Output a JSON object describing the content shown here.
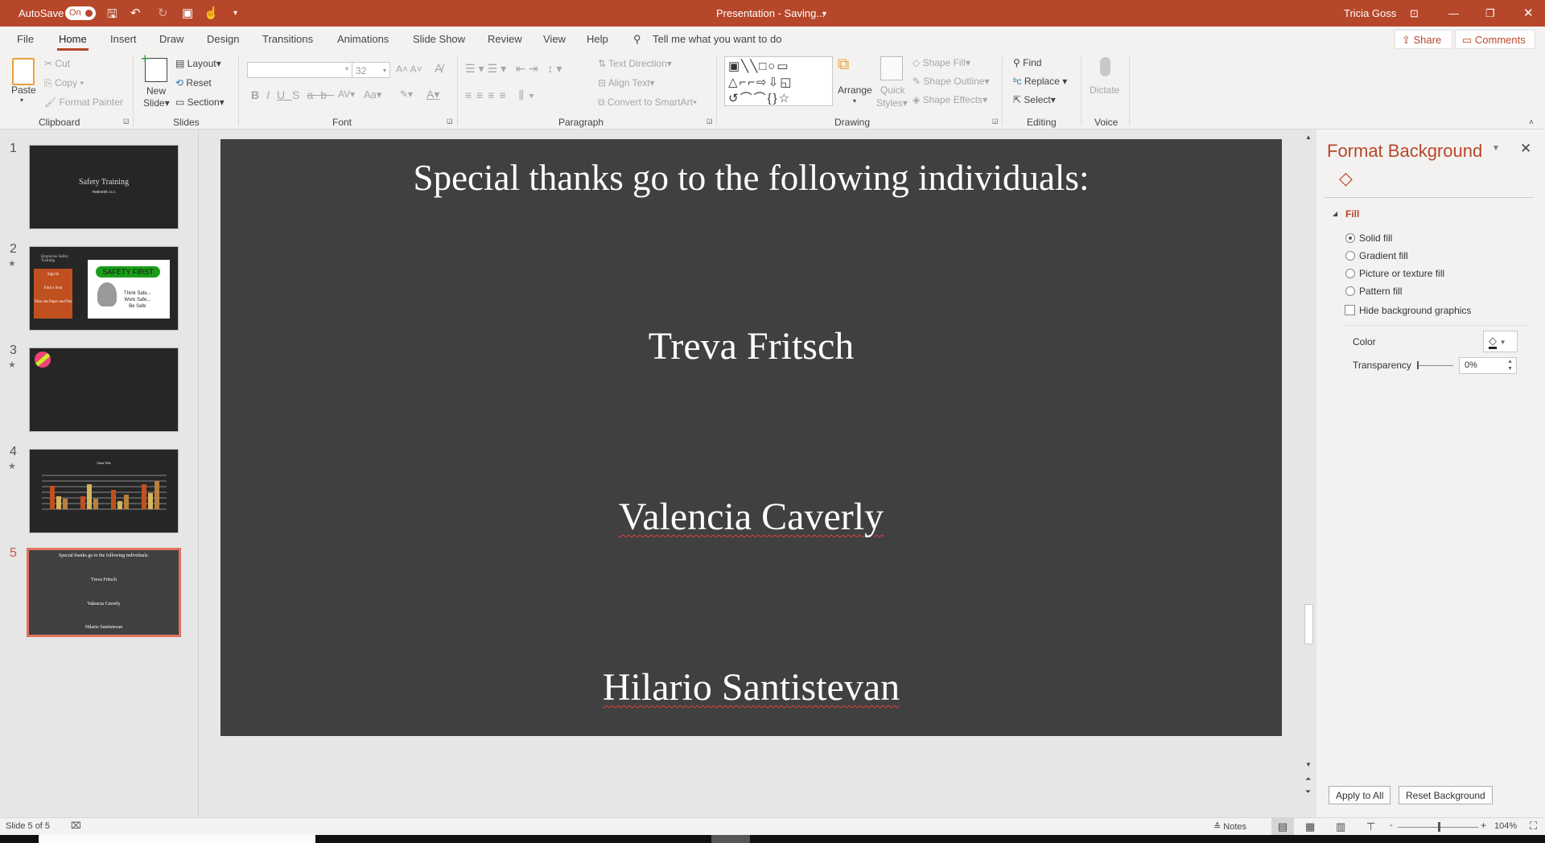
{
  "titlebar": {
    "autosave_label": "AutoSave",
    "autosave_state": "On",
    "title": "Presentation - Saving...",
    "user": "Tricia Goss",
    "accent": "#b7472a"
  },
  "tabs": [
    "File",
    "Home",
    "Insert",
    "Draw",
    "Design",
    "Transitions",
    "Animations",
    "Slide Show",
    "Review",
    "View",
    "Help"
  ],
  "active_tab": "Home",
  "search": {
    "placeholder": "Tell me what you want to do"
  },
  "share_label": "Share",
  "comments_label": "Comments",
  "ribbon": {
    "clipboard": {
      "paste": "Paste",
      "cut": "Cut",
      "copy": "Copy",
      "format_painter": "Format Painter",
      "label": "Clipboard"
    },
    "slides": {
      "new": "New",
      "slide": "Slide",
      "layout": "Layout",
      "reset": "Reset",
      "section": "Section",
      "label": "Slides"
    },
    "font": {
      "font_name": "",
      "font_size": "32",
      "label": "Font"
    },
    "paragraph": {
      "text_direction": "Text Direction",
      "align_text": "Align Text",
      "smartart": "Convert to SmartArt",
      "label": "Paragraph"
    },
    "drawing": {
      "arrange": "Arrange",
      "quick": "Quick",
      "styles": "Styles",
      "shape_fill": "Shape Fill",
      "shape_outline": "Shape Outline",
      "shape_effects": "Shape Effects",
      "label": "Drawing"
    },
    "editing": {
      "find": "Find",
      "replace": "Replace",
      "select": "Select",
      "label": "Editing"
    },
    "voice": {
      "dictate": "Dictate",
      "label": "Voice"
    }
  },
  "thumbnails": [
    {
      "num": "1",
      "title": "Safety Training",
      "subtitle": "PARKSIDE, LLC"
    },
    {
      "num": "2",
      "title": "Employee Safety Training",
      "items": [
        "Sign In",
        "Find a Seat",
        "Take out Paper and Pen"
      ],
      "banner": "SAFETY FIRST",
      "lines": [
        "Think Safe...",
        "Work Safe...",
        "Be Safe"
      ]
    },
    {
      "num": "3"
    },
    {
      "num": "4",
      "title": "Chart Title"
    },
    {
      "num": "5",
      "title": "Special thanks go to the following individuals:",
      "names": [
        "Treva Fritsch",
        "Valencia Caverly",
        "Hilario Santistevan"
      ]
    }
  ],
  "slide": {
    "title": "Special thanks go to the following individuals:",
    "names": [
      "Treva Fritsch",
      "Valencia Caverly",
      "Hilario Santistevan"
    ],
    "background": "#404040"
  },
  "panel": {
    "title": "Format Background",
    "section": "Fill",
    "options": [
      "Solid fill",
      "Gradient fill",
      "Picture or texture fill",
      "Pattern fill"
    ],
    "selected": "Solid fill",
    "hide_bg": "Hide background graphics",
    "color_label": "Color",
    "transparency_label": "Transparency",
    "transparency_value": "0%",
    "apply_all": "Apply to All",
    "reset_bg": "Reset Background"
  },
  "status": {
    "slide_info": "Slide 5 of 5",
    "notes": "Notes",
    "zoom": "104%"
  }
}
